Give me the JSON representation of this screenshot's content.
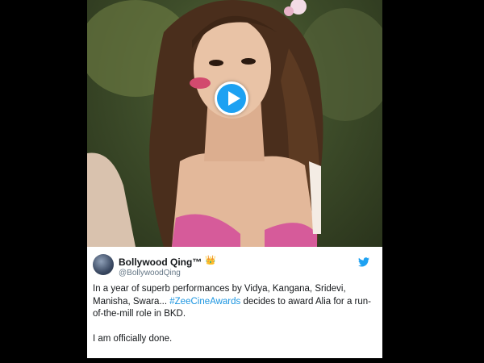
{
  "tweet": {
    "display_name": "Bollywood Qing™",
    "badge_emoji": "👑",
    "handle": "@BollywoodQing",
    "text_part1": "In a year of superb performances by Vidya, Kangana, Sridevi, Manisha, Swara...",
    "hashtag": "#ZeeCineAwards",
    "text_part2": "decides to award Alia for a run-of-the-mill role in BKD.",
    "text_line2": "I am officially done."
  },
  "icons": {
    "play": "play-icon",
    "platform": "twitter-bird-icon",
    "badge": "crown-icon"
  },
  "colors": {
    "accent": "#1da1f2",
    "hashtag": "#1b95e0",
    "text": "#14171a",
    "muted": "#657786",
    "background": "#000000"
  }
}
